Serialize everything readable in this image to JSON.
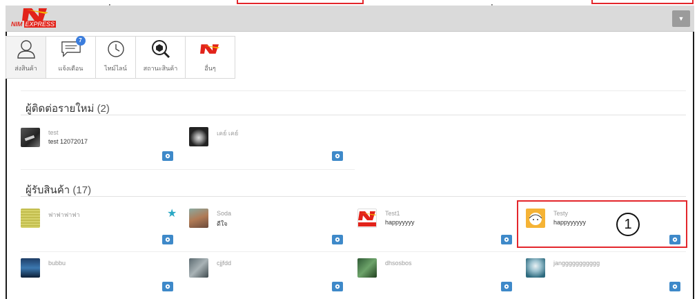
{
  "app": {
    "logo_text": "NIM",
    "logo_sub": "EXPRESS",
    "menu_icon": "caret-down-icon"
  },
  "tabs": [
    {
      "label": "ส่งสินค้า",
      "icon": "user-icon",
      "active": true
    },
    {
      "label": "แจ้งเตือน",
      "icon": "chat-icon",
      "badge": "7"
    },
    {
      "label": "ไทม์ไลน์",
      "icon": "clock-icon"
    },
    {
      "label": "สถานะสินค้า",
      "icon": "box-search-icon"
    },
    {
      "label": "อื่นๆ",
      "icon": "nim-logo-icon"
    }
  ],
  "new_contacts": {
    "title": "ผู้ติดต่อรายใหม่",
    "count": "(2)",
    "items": [
      {
        "name": "test",
        "message": "test 12072017",
        "avatar": "photo-dark"
      },
      {
        "name": "เคย์ เคย์",
        "message": "",
        "avatar": "photo-anime"
      }
    ]
  },
  "receivers": {
    "title": "ผู้รับสินค้า",
    "count": "(17)",
    "items": [
      {
        "name": "ฟาฟาฟาฟา",
        "message": "",
        "avatar": "yellow-paper",
        "starred": true
      },
      {
        "name": "Soda",
        "message": "ดีใจ",
        "avatar": "photo-person"
      },
      {
        "name": "Test1",
        "message": "happyyyyy",
        "avatar": "nim-logo"
      },
      {
        "name": "Testy",
        "message": "happyyyyyy",
        "avatar": "emoji-face"
      },
      {
        "name": "bubbu",
        "message": "",
        "avatar": "photo-blue"
      },
      {
        "name": "cjjfdd",
        "message": "",
        "avatar": "photo-grey"
      },
      {
        "name": "dhsosbos",
        "message": "",
        "avatar": "photo-green"
      },
      {
        "name": "janggggggggggg",
        "message": "",
        "avatar": "photo-anime-2"
      }
    ]
  },
  "annotation": {
    "number": "1"
  },
  "colors": {
    "accent_blue": "#3e89c9",
    "brand_red": "#e2231a",
    "highlight_red": "#e3262b"
  }
}
